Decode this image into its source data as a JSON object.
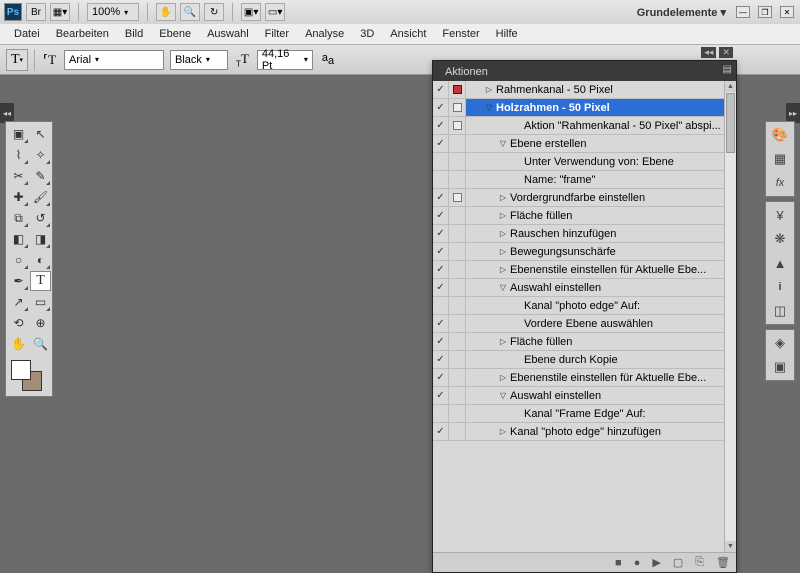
{
  "titlebar": {
    "zoom": "100%",
    "workspace": "Grundelemente"
  },
  "menu": {
    "datei": "Datei",
    "bearbeiten": "Bearbeiten",
    "bild": "Bild",
    "ebene": "Ebene",
    "auswahl": "Auswahl",
    "filter": "Filter",
    "analyse": "Analyse",
    "dreid": "3D",
    "ansicht": "Ansicht",
    "fenster": "Fenster",
    "hilfe": "Hilfe"
  },
  "options": {
    "font_family": "Arial",
    "font_style": "Black",
    "font_size": "44,16 Pt"
  },
  "panel": {
    "title": "Aktionen"
  },
  "actions": [
    {
      "check": true,
      "mod": "red",
      "ind": 1,
      "tw": "▷",
      "txt": "Rahmenkanal - 50 Pixel",
      "sel": false
    },
    {
      "check": true,
      "mod": "box",
      "ind": 1,
      "tw": "▽",
      "txt": "Holzrahmen - 50 Pixel",
      "sel": true
    },
    {
      "check": true,
      "mod": "box",
      "ind": 3,
      "tw": "",
      "txt": "Aktion \"Rahmenkanal - 50 Pixel\" abspi...",
      "sel": false
    },
    {
      "check": true,
      "mod": "",
      "ind": 2,
      "tw": "▽",
      "txt": "Ebene erstellen",
      "sel": false
    },
    {
      "check": null,
      "mod": "",
      "ind": 3,
      "tw": "",
      "txt": "Unter Verwendung von: Ebene",
      "sel": false
    },
    {
      "check": null,
      "mod": "",
      "ind": 3,
      "tw": "",
      "txt": "Name:  \"frame\"",
      "sel": false
    },
    {
      "check": true,
      "mod": "box",
      "ind": 2,
      "tw": "▷",
      "txt": "Vordergrundfarbe einstellen",
      "sel": false
    },
    {
      "check": true,
      "mod": "",
      "ind": 2,
      "tw": "▷",
      "txt": "Fläche füllen",
      "sel": false
    },
    {
      "check": true,
      "mod": "",
      "ind": 2,
      "tw": "▷",
      "txt": "Rauschen hinzufügen",
      "sel": false
    },
    {
      "check": true,
      "mod": "",
      "ind": 2,
      "tw": "▷",
      "txt": "Bewegungsunschärfe",
      "sel": false
    },
    {
      "check": true,
      "mod": "",
      "ind": 2,
      "tw": "▷",
      "txt": "Ebenenstile einstellen  für Aktuelle Ebe...",
      "sel": false
    },
    {
      "check": true,
      "mod": "",
      "ind": 2,
      "tw": "▽",
      "txt": "Auswahl einstellen",
      "sel": false
    },
    {
      "check": null,
      "mod": "",
      "ind": 3,
      "tw": "",
      "txt": "Kanal \"photo edge\" Auf:",
      "sel": false
    },
    {
      "check": true,
      "mod": "",
      "ind": 3,
      "tw": "",
      "txt": "Vordere Ebene auswählen",
      "sel": false
    },
    {
      "check": true,
      "mod": "",
      "ind": 2,
      "tw": "▷",
      "txt": "Fläche füllen",
      "sel": false
    },
    {
      "check": true,
      "mod": "",
      "ind": 3,
      "tw": "",
      "txt": "Ebene durch Kopie",
      "sel": false
    },
    {
      "check": true,
      "mod": "",
      "ind": 2,
      "tw": "▷",
      "txt": "Ebenenstile einstellen  für Aktuelle Ebe...",
      "sel": false
    },
    {
      "check": true,
      "mod": "",
      "ind": 2,
      "tw": "▽",
      "txt": "Auswahl einstellen",
      "sel": false
    },
    {
      "check": null,
      "mod": "",
      "ind": 3,
      "tw": "",
      "txt": "Kanal \"Frame Edge\" Auf:",
      "sel": false
    },
    {
      "check": true,
      "mod": "",
      "ind": 2,
      "tw": "▷",
      "txt": "Kanal \"photo edge\" hinzufügen",
      "sel": false
    }
  ]
}
